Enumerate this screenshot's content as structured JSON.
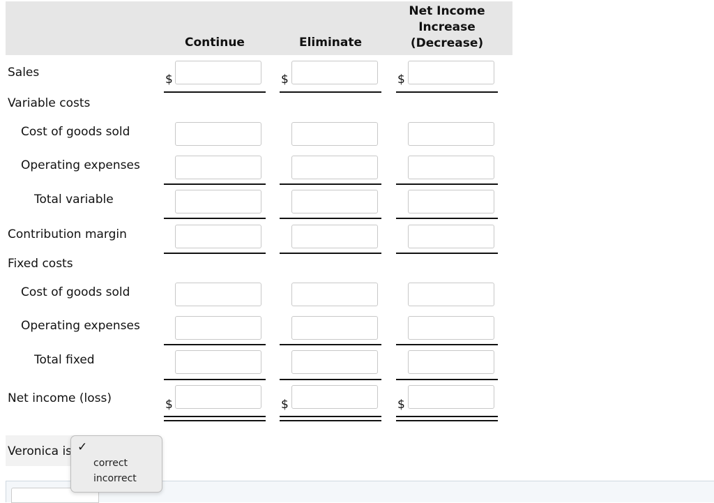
{
  "columns": {
    "continue": "Continue",
    "eliminate": "Eliminate",
    "net_line1": "Net Income",
    "net_line2": "Increase",
    "net_line3": "(Decrease)"
  },
  "currency_symbol": "$",
  "rows": {
    "sales": "Sales",
    "variable_costs": "Variable costs",
    "var_cogs": "Cost of goods sold",
    "var_opex": "Operating expenses",
    "total_variable": "Total variable",
    "contribution_margin": "Contribution margin",
    "fixed_costs": "Fixed costs",
    "fix_cogs": "Cost of goods sold",
    "fix_opex": "Operating expenses",
    "total_fixed": "Total fixed",
    "net_income": "Net income (loss)"
  },
  "inputs": {
    "sales": [
      "",
      "",
      ""
    ],
    "var_cogs": [
      "",
      "",
      ""
    ],
    "var_opex": [
      "",
      "",
      ""
    ],
    "total_variable": [
      "",
      "",
      ""
    ],
    "contribution_margin": [
      "",
      "",
      ""
    ],
    "fix_cogs": [
      "",
      "",
      ""
    ],
    "fix_opex": [
      "",
      "",
      ""
    ],
    "total_fixed": [
      "",
      "",
      ""
    ],
    "net_income": [
      "",
      "",
      ""
    ]
  },
  "conclusion": {
    "prefix": "Veronica is",
    "dropdown": {
      "selected_mark": "✓",
      "options": [
        "correct",
        "incorrect"
      ]
    }
  }
}
